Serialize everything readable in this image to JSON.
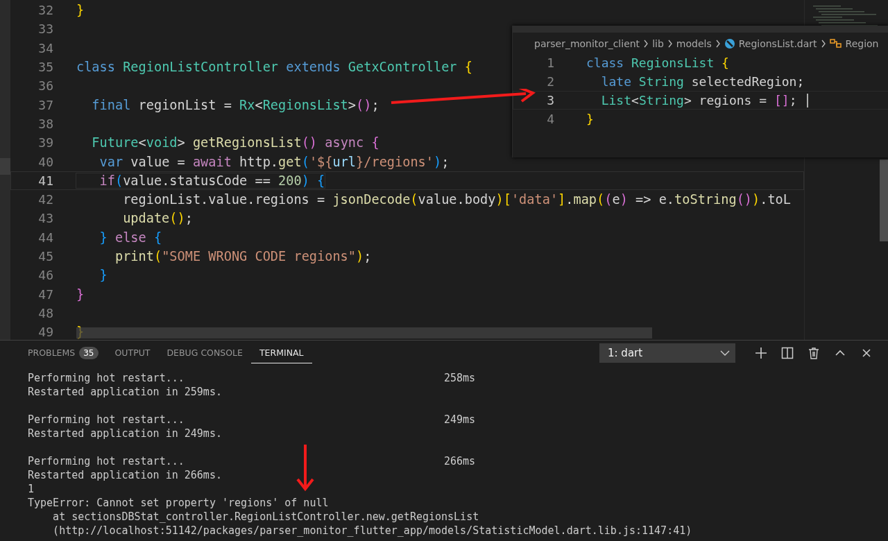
{
  "editor": {
    "lines": [
      {
        "number": "32",
        "current": false,
        "tokens": [
          {
            "kind": "brace",
            "text": "}"
          }
        ]
      },
      {
        "number": "33",
        "current": false
      },
      {
        "number": "34",
        "current": false
      },
      {
        "number": "35",
        "current": false,
        "tokens": [
          {
            "kind": "keyword",
            "text": "class "
          },
          {
            "kind": "type",
            "text": "RegionListController "
          },
          {
            "kind": "keyword",
            "text": "extends "
          },
          {
            "kind": "type",
            "text": "GetxController "
          },
          {
            "kind": "brace",
            "text": "{"
          }
        ]
      },
      {
        "number": "36",
        "current": false
      },
      {
        "number": "37",
        "current": false,
        "tokens": [
          {
            "kind": "keyword",
            "text": "  final "
          },
          {
            "kind": "plain",
            "text": "regionList = "
          },
          {
            "kind": "type",
            "text": "Rx"
          },
          {
            "kind": "plain",
            "text": "<"
          },
          {
            "kind": "type",
            "text": "RegionsList"
          },
          {
            "kind": "plain",
            "text": ">"
          },
          {
            "kind": "brace2",
            "text": "()"
          },
          {
            "kind": "plain",
            "text": ";"
          }
        ]
      },
      {
        "number": "38",
        "current": false
      },
      {
        "number": "39",
        "current": false,
        "tokens": [
          {
            "kind": "type",
            "text": "  Future"
          },
          {
            "kind": "plain",
            "text": "<"
          },
          {
            "kind": "type",
            "text": "void"
          },
          {
            "kind": "plain",
            "text": "> "
          },
          {
            "kind": "func",
            "text": "getRegionsList"
          },
          {
            "kind": "brace2",
            "text": "() "
          },
          {
            "kind": "control",
            "text": "async "
          },
          {
            "kind": "brace2",
            "text": "{"
          }
        ]
      },
      {
        "number": "40",
        "current": false,
        "tokens": [
          {
            "kind": "keyword",
            "text": "   var "
          },
          {
            "kind": "plain",
            "text": "value = "
          },
          {
            "kind": "control",
            "text": "await "
          },
          {
            "kind": "plain",
            "text": "http."
          },
          {
            "kind": "func",
            "text": "get"
          },
          {
            "kind": "brace3",
            "text": "("
          },
          {
            "kind": "string",
            "text": "'${"
          },
          {
            "kind": "variable",
            "text": "url"
          },
          {
            "kind": "string",
            "text": "}/regions'"
          },
          {
            "kind": "brace3",
            "text": ")"
          },
          {
            "kind": "plain",
            "text": ";"
          }
        ]
      },
      {
        "number": "41",
        "current": true,
        "tokens": [
          {
            "kind": "control",
            "text": "   if"
          },
          {
            "kind": "brace3",
            "text": "("
          },
          {
            "kind": "plain",
            "text": "value.statusCode == "
          },
          {
            "kind": "number",
            "text": "200"
          },
          {
            "kind": "brace3",
            "text": ") {"
          }
        ]
      },
      {
        "number": "42",
        "current": false,
        "tokens": [
          {
            "kind": "plain",
            "text": "      regionList.value.regions = "
          },
          {
            "kind": "func",
            "text": "jsonDecode"
          },
          {
            "kind": "brace",
            "text": "("
          },
          {
            "kind": "plain",
            "text": "value.body"
          },
          {
            "kind": "brace",
            "text": ")["
          },
          {
            "kind": "string",
            "text": "'data'"
          },
          {
            "kind": "brace",
            "text": "]"
          },
          {
            "kind": "plain",
            "text": "."
          },
          {
            "kind": "func",
            "text": "map"
          },
          {
            "kind": "brace",
            "text": "("
          },
          {
            "kind": "brace2",
            "text": "("
          },
          {
            "kind": "plain",
            "text": "e"
          },
          {
            "kind": "brace2",
            "text": ")"
          },
          {
            "kind": "plain",
            "text": " => e."
          },
          {
            "kind": "func",
            "text": "toString"
          },
          {
            "kind": "brace2",
            "text": "()"
          },
          {
            "kind": "brace",
            "text": ")"
          },
          {
            "kind": "plain",
            "text": ".toL"
          }
        ]
      },
      {
        "number": "43",
        "current": false,
        "tokens": [
          {
            "kind": "func",
            "text": "      update"
          },
          {
            "kind": "brace",
            "text": "()"
          },
          {
            "kind": "plain",
            "text": ";"
          }
        ]
      },
      {
        "number": "44",
        "current": false,
        "tokens": [
          {
            "kind": "brace3",
            "text": "   } "
          },
          {
            "kind": "control",
            "text": "else "
          },
          {
            "kind": "brace3",
            "text": "{"
          }
        ]
      },
      {
        "number": "45",
        "current": false,
        "tokens": [
          {
            "kind": "func",
            "text": "     print"
          },
          {
            "kind": "brace",
            "text": "("
          },
          {
            "kind": "string",
            "text": "\"SOME WRONG CODE regions\""
          },
          {
            "kind": "brace",
            "text": ")"
          },
          {
            "kind": "plain",
            "text": ";"
          }
        ]
      },
      {
        "number": "46",
        "current": false,
        "tokens": [
          {
            "kind": "brace3",
            "text": "   }"
          }
        ]
      },
      {
        "number": "47",
        "current": false,
        "tokens": [
          {
            "kind": "brace2",
            "text": "}"
          }
        ]
      },
      {
        "number": "48",
        "current": false
      },
      {
        "number": "49",
        "current": false,
        "tokens": [
          {
            "kind": "brace",
            "text": "}"
          }
        ]
      }
    ]
  },
  "peek": {
    "breadcrumbs": [
      {
        "kind": "text",
        "text": "parser_monitor_client"
      },
      {
        "kind": "text",
        "text": "lib"
      },
      {
        "kind": "text",
        "text": "models"
      },
      {
        "kind": "dart",
        "text": "RegionsList.dart"
      },
      {
        "kind": "class",
        "text": "Region"
      }
    ],
    "lines": [
      {
        "number": "1",
        "current": false,
        "tokens": [
          {
            "kind": "keyword",
            "text": "class "
          },
          {
            "kind": "type",
            "text": "RegionsList "
          },
          {
            "kind": "brace",
            "text": "{"
          }
        ]
      },
      {
        "number": "2",
        "current": false,
        "tokens": [
          {
            "kind": "keyword",
            "text": "  late "
          },
          {
            "kind": "type",
            "text": "String "
          },
          {
            "kind": "plain",
            "text": "selectedRegion;"
          }
        ]
      },
      {
        "number": "3",
        "current": true,
        "tokens": [
          {
            "kind": "type",
            "text": "  List"
          },
          {
            "kind": "plain",
            "text": "<"
          },
          {
            "kind": "type",
            "text": "String"
          },
          {
            "kind": "plain",
            "text": "> regions = "
          },
          {
            "kind": "brace2",
            "text": "[]"
          },
          {
            "kind": "plain",
            "text": "; "
          }
        ]
      },
      {
        "number": "4",
        "current": false,
        "tokens": [
          {
            "kind": "brace",
            "text": "}"
          }
        ]
      }
    ]
  },
  "panel": {
    "tabs": [
      {
        "label": "PROBLEMS",
        "badge": "35",
        "selected": false
      },
      {
        "label": "OUTPUT",
        "selected": false
      },
      {
        "label": "DEBUG CONSOLE",
        "selected": false
      },
      {
        "label": "TERMINAL",
        "selected": true
      }
    ],
    "terminal_select": "1: dart",
    "terminal_blocks": [
      {
        "lines": [
          {
            "text": "Performing hot restart...",
            "time": "258ms"
          },
          {
            "text": "Restarted application in 259ms."
          }
        ]
      },
      {
        "lines": [
          {
            "text": "Performing hot restart...",
            "time": "249ms"
          },
          {
            "text": "Restarted application in 249ms."
          }
        ]
      },
      {
        "lines": [
          {
            "text": "Performing hot restart...",
            "time": "266ms"
          },
          {
            "text": "Restarted application in 266ms."
          },
          {
            "text": "1"
          },
          {
            "text": "TypeError: Cannot set property 'regions' of null"
          },
          {
            "text": "    at sectionsDBStat_controller.RegionListController.new.getRegionsList"
          },
          {
            "text": "    (http://localhost:51142/packages/parser_monitor_flutter_app/models/StatisticModel.dart.lib.js:1147:41)"
          }
        ]
      }
    ]
  }
}
